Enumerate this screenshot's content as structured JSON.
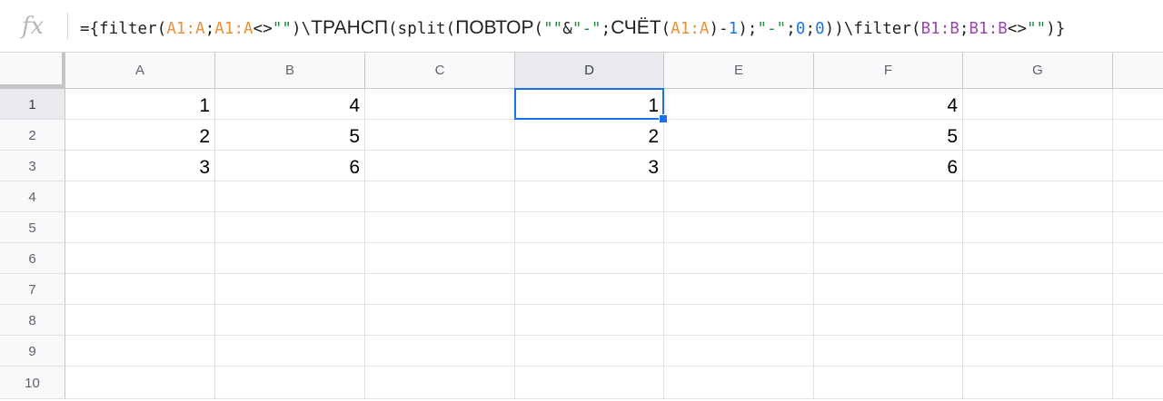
{
  "formula_bar": {
    "fx_label": "fx",
    "segments": [
      {
        "text": "={filter(",
        "color": "default",
        "font": "mono"
      },
      {
        "text": "A1:A",
        "color": "orange",
        "font": "mono"
      },
      {
        "text": ";",
        "color": "default",
        "font": "mono"
      },
      {
        "text": "A1:A",
        "color": "orange",
        "font": "mono"
      },
      {
        "text": "<>",
        "color": "default",
        "font": "mono"
      },
      {
        "text": "\"\"",
        "color": "green",
        "font": "mono"
      },
      {
        "text": ")\\",
        "color": "default",
        "font": "mono"
      },
      {
        "text": "ТРАНСП",
        "color": "default",
        "font": "sans"
      },
      {
        "text": "(split(",
        "color": "default",
        "font": "mono"
      },
      {
        "text": "ПОВТОР",
        "color": "default",
        "font": "sans"
      },
      {
        "text": "(",
        "color": "default",
        "font": "mono"
      },
      {
        "text": "\"\"",
        "color": "green",
        "font": "mono"
      },
      {
        "text": "&",
        "color": "default",
        "font": "mono"
      },
      {
        "text": "\"-\"",
        "color": "green",
        "font": "mono"
      },
      {
        "text": ";",
        "color": "default",
        "font": "mono"
      },
      {
        "text": "СЧЁТ",
        "color": "default",
        "font": "sans"
      },
      {
        "text": "(",
        "color": "default",
        "font": "mono"
      },
      {
        "text": "A1:A",
        "color": "orange",
        "font": "mono"
      },
      {
        "text": ")-",
        "color": "default",
        "font": "mono"
      },
      {
        "text": "1",
        "color": "blue",
        "font": "mono"
      },
      {
        "text": ");",
        "color": "default",
        "font": "mono"
      },
      {
        "text": "\"-\"",
        "color": "green",
        "font": "mono"
      },
      {
        "text": ";",
        "color": "default",
        "font": "mono"
      },
      {
        "text": "0",
        "color": "blue",
        "font": "mono"
      },
      {
        "text": ";",
        "color": "default",
        "font": "mono"
      },
      {
        "text": "0",
        "color": "blue",
        "font": "mono"
      },
      {
        "text": "))\\filter(",
        "color": "default",
        "font": "mono"
      },
      {
        "text": "B1:B",
        "color": "purple",
        "font": "mono"
      },
      {
        "text": ";",
        "color": "default",
        "font": "mono"
      },
      {
        "text": "B1:B",
        "color": "purple",
        "font": "mono"
      },
      {
        "text": "<>",
        "color": "default",
        "font": "mono"
      },
      {
        "text": "\"\"",
        "color": "green",
        "font": "mono"
      },
      {
        "text": ")}",
        "color": "default",
        "font": "mono"
      }
    ]
  },
  "colors": {
    "selection": "#1a73e8",
    "ref_a": "#e69138",
    "string": "#1e8e3e",
    "number": "#1a73e8",
    "ref_b": "#9c45b4"
  },
  "columns": [
    "A",
    "B",
    "C",
    "D",
    "E",
    "F",
    "G"
  ],
  "rows": [
    "1",
    "2",
    "3",
    "4",
    "5",
    "6",
    "7",
    "8",
    "9",
    "10"
  ],
  "active_cell": {
    "column": "D",
    "row": "1"
  },
  "cells": {
    "A1": "1",
    "A2": "2",
    "A3": "3",
    "B1": "4",
    "B2": "5",
    "B3": "6",
    "D1": "1",
    "D2": "2",
    "D3": "3",
    "F1": "4",
    "F2": "5",
    "F3": "6"
  }
}
